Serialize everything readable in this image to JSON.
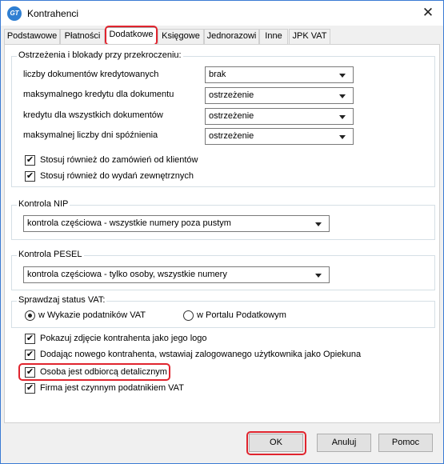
{
  "window": {
    "title": "Kontrahenci",
    "app_icon_text": "GT"
  },
  "tabs": [
    "Podstawowe",
    "Płatności",
    "Dodatkowe",
    "Księgowe",
    "Jednorazowi",
    "Inne",
    "JPK VAT"
  ],
  "warnings": {
    "title": "Ostrzeżenia i blokady przy przekroczeniu:",
    "rows": [
      {
        "label": "liczby dokumentów kredytowanych",
        "value": "brak"
      },
      {
        "label": "maksymalnego kredytu dla  dokumentu",
        "value": "ostrzeżenie"
      },
      {
        "label": "kredytu dla wszystkich dokumentów",
        "value": "ostrzeżenie"
      },
      {
        "label": "maksymalnej liczby dni spóźnienia",
        "value": "ostrzeżenie"
      }
    ],
    "checks": [
      {
        "label": "Stosuj również do zamówień od klientów",
        "checked": true
      },
      {
        "label": "Stosuj również do wydań zewnętrznych",
        "checked": true
      }
    ]
  },
  "nip": {
    "title": "Kontrola NIP",
    "value": "kontrola częściowa - wszystkie numery poza pustym"
  },
  "pesel": {
    "title": "Kontrola PESEL",
    "value": "kontrola częściowa - tylko osoby, wszystkie numery"
  },
  "vat": {
    "title": "Sprawdzaj status VAT:",
    "options": [
      {
        "label": "w Wykazie podatników VAT",
        "selected": true
      },
      {
        "label": "w Portalu Podatkowym",
        "selected": false
      }
    ]
  },
  "options": [
    {
      "label": "Pokazuj zdjęcie kontrahenta jako jego logo",
      "checked": true
    },
    {
      "label": "Dodając nowego kontrahenta, wstawiaj zalogowanego użytkownika jako Opiekuna",
      "checked": true
    },
    {
      "label": "Osoba jest odbiorcą detalicznym",
      "checked": true
    },
    {
      "label": "Firma jest czynnym podatnikiem VAT",
      "checked": true
    }
  ],
  "buttons": {
    "ok": "OK",
    "cancel": "Anuluj",
    "help": "Pomoc"
  },
  "check_glyph": "✔",
  "close_glyph": "✕",
  "colors": {
    "highlight": "#e0242e",
    "titlebar_border": "#3b7bd4"
  }
}
